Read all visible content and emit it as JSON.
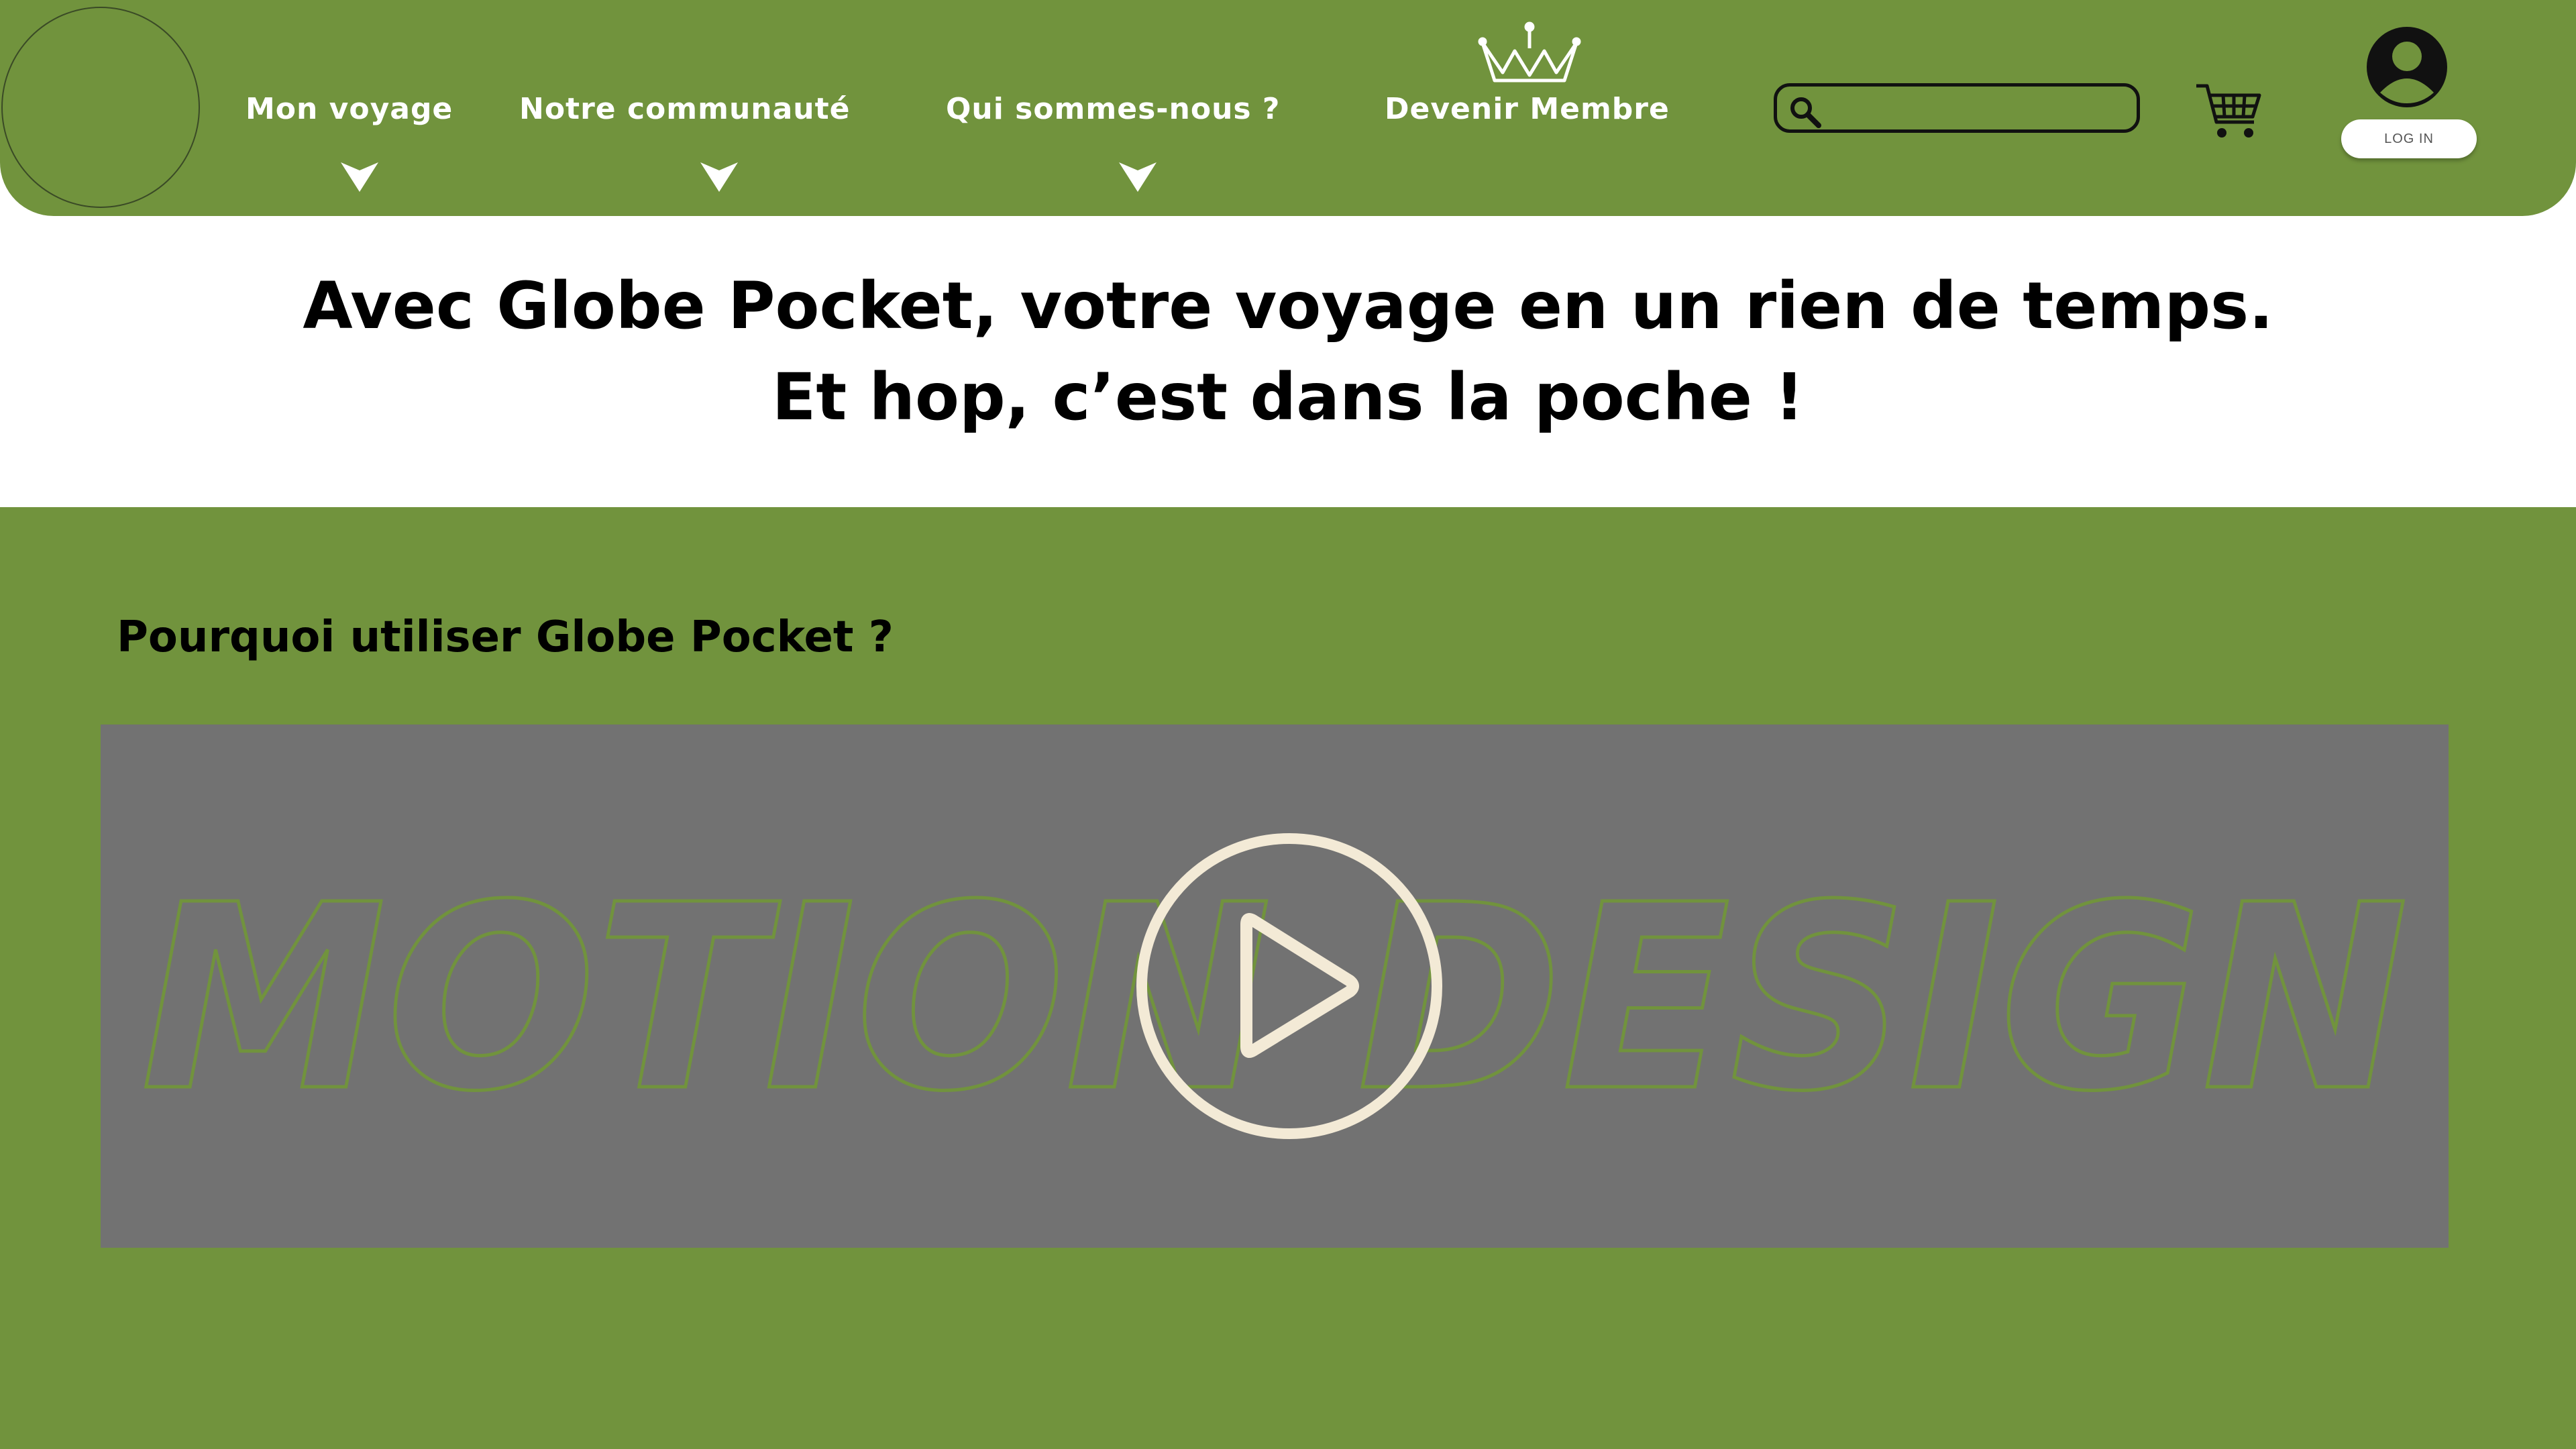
{
  "header": {
    "nav": [
      {
        "label": "Mon voyage"
      },
      {
        "label": "Notre communauté"
      },
      {
        "label": "Qui sommes-nous ?"
      },
      {
        "label": "Devenir Membre"
      }
    ],
    "search": {
      "value": "",
      "placeholder": ""
    },
    "login_label": "LOG IN"
  },
  "hero": {
    "line1": "Avec Globe Pocket, votre voyage en un rien de temps.",
    "line2": "Et hop, c’est dans la poche !"
  },
  "section": {
    "title": "Pourquoi utiliser Globe Pocket ?",
    "video_overlay_text": "MOTION DESIGN"
  },
  "colors": {
    "brand_green": "#71933d",
    "video_bg": "#727272",
    "play_icon": "#f3ead6"
  },
  "icons": [
    "crown-icon",
    "search-icon",
    "cart-icon",
    "user-icon",
    "chevron-down-icon",
    "play-icon"
  ]
}
